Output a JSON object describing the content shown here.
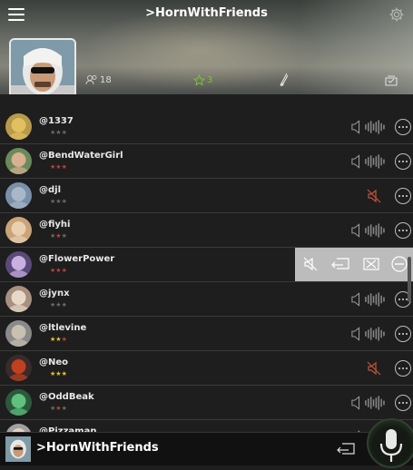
{
  "app": {
    "title": ">HornWithFriends"
  },
  "profile": {
    "followers": "18",
    "stars": "3"
  },
  "contacts": [
    {
      "name": "@1337",
      "stars": [
        0,
        0,
        0
      ],
      "muted": false
    },
    {
      "name": "@BendWaterGirl",
      "stars": [
        1,
        1,
        1
      ],
      "muted": false
    },
    {
      "name": "@djl",
      "stars": [
        0,
        0,
        0
      ],
      "muted": true
    },
    {
      "name": "@fiyhi",
      "stars": [
        0,
        1,
        0
      ],
      "muted": false
    },
    {
      "name": "@FlowerPower",
      "stars": [
        1,
        1,
        1
      ],
      "muted": false,
      "actions_open": true
    },
    {
      "name": "@jynx",
      "stars": [
        0,
        0,
        0
      ],
      "muted": false
    },
    {
      "name": "@ltlevine",
      "stars": [
        2,
        2,
        1
      ],
      "muted": false
    },
    {
      "name": "@Neo",
      "stars": [
        2,
        2,
        2
      ],
      "muted": true
    },
    {
      "name": "@OddBeak",
      "stars": [
        0,
        1,
        0
      ],
      "muted": false
    },
    {
      "name": "@Pizzaman",
      "stars": [
        0,
        0,
        0
      ],
      "muted": false
    }
  ],
  "bottom_bar": {
    "title": ">HornWithFriends"
  },
  "colors": {
    "star_gold": "#e9c233",
    "star_red": "#b8453a",
    "star_dim": "#6a6a6a",
    "star_green": "#7ec23a",
    "mute_red": "#c0533a"
  }
}
